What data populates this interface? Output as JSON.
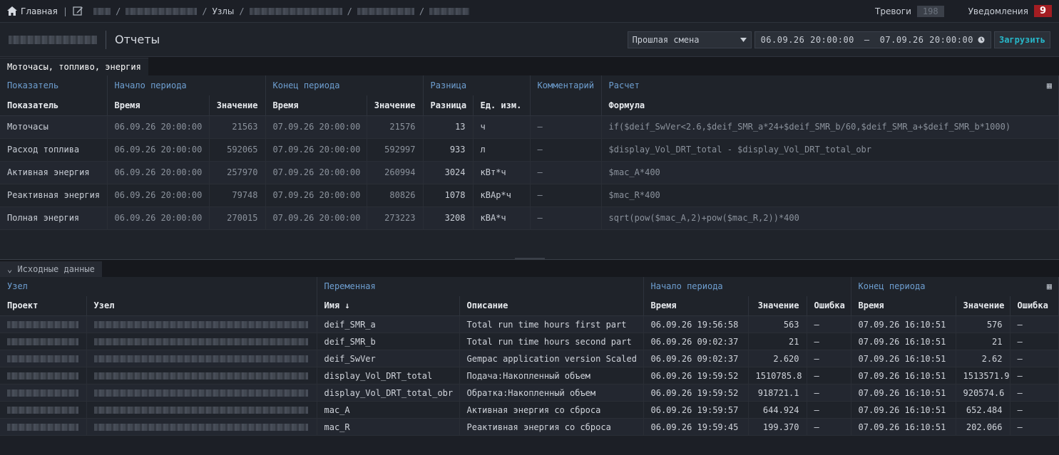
{
  "topbar": {
    "home_label": "Главная",
    "crumb_nodes": "Узлы",
    "alarms_label": "Тревоги",
    "alarms_count": "198",
    "notifications_label": "Уведомления",
    "notifications_count": "9"
  },
  "header": {
    "title": "Отчеты",
    "period_select": "Прошлая смена",
    "date_from": "06.09.26  20:00:00",
    "date_dash": "—",
    "date_to": "07.09.26  20:00:00",
    "load_button": "Загрузить"
  },
  "report_tab": "Моточасы, топливо, энергия",
  "report_table": {
    "groups": [
      "Показатель",
      "Начало периода",
      "Конец периода",
      "Разница",
      "Комментарий",
      "Расчет"
    ],
    "columns": [
      "Показатель",
      "Время",
      "Значение",
      "Время",
      "Значение",
      "Разница",
      "Ед. изм.",
      "",
      "Формула"
    ],
    "rows": [
      [
        "Моточасы",
        "06.09.26 20:00:00",
        "21563",
        "07.09.26 20:00:00",
        "21576",
        "13",
        "ч",
        "—",
        "if($deif_SwVer<2.6,$deif_SMR_a*24+$deif_SMR_b/60,$deif_SMR_a+$deif_SMR_b*1000)"
      ],
      [
        "Расход топлива",
        "06.09.26 20:00:00",
        "592065",
        "07.09.26 20:00:00",
        "592997",
        "933",
        "л",
        "—",
        "$display_Vol_DRT_total - $display_Vol_DRT_total_obr"
      ],
      [
        "Активная энергия",
        "06.09.26 20:00:00",
        "257970",
        "07.09.26 20:00:00",
        "260994",
        "3024",
        "кВт*ч",
        "—",
        "$mac_A*400"
      ],
      [
        "Реактивная энергия",
        "06.09.26 20:00:00",
        "79748",
        "07.09.26 20:00:00",
        "80826",
        "1078",
        "кВАр*ч",
        "—",
        "$mac_R*400"
      ],
      [
        "Полная энергия",
        "06.09.26 20:00:00",
        "270015",
        "07.09.26 20:00:00",
        "273223",
        "3208",
        "кВА*ч",
        "—",
        "sqrt(pow($mac_A,2)+pow($mac_R,2))*400"
      ]
    ]
  },
  "source_tab": "Исходные данные",
  "source_table": {
    "groups": [
      "Узел",
      "Переменная",
      "Начало периода",
      "Конец периода"
    ],
    "columns": [
      "Проект",
      "Узел",
      "Имя ↓",
      "Описание",
      "Время",
      "Значение",
      "Ошибка",
      "Время",
      "Значение",
      "Ошибка"
    ],
    "rows": [
      [
        "deif_SMR_a",
        "Total run time hours first part",
        "06.09.26 19:56:58",
        "563",
        "—",
        "07.09.26 16:10:51",
        "576",
        "—"
      ],
      [
        "deif_SMR_b",
        "Total run time hours second part",
        "06.09.26 09:02:37",
        "21",
        "—",
        "07.09.26 16:10:51",
        "21",
        "—"
      ],
      [
        "deif_SwVer",
        "Gempac application version Scaled",
        "06.09.26 09:02:37",
        "2.620",
        "—",
        "07.09.26 16:10:51",
        "2.62",
        "—"
      ],
      [
        "display_Vol_DRT_total",
        "Подача:Накопленный объем",
        "06.09.26 19:59:52",
        "1510785.8",
        "—",
        "07.09.26 16:10:51",
        "1513571.9",
        "—"
      ],
      [
        "display_Vol_DRT_total_obr",
        "Обратка:Накопленный объем",
        "06.09.26 19:59:52",
        "918721.1",
        "—",
        "07.09.26 16:10:51",
        "920574.6",
        "—"
      ],
      [
        "mac_A",
        "Активная энергия со сброса",
        "06.09.26 19:59:57",
        "644.924",
        "—",
        "07.09.26 16:10:51",
        "652.484",
        "—"
      ],
      [
        "mac_R",
        "Реактивная энергия со сброса",
        "06.09.26 19:59:45",
        "199.370",
        "—",
        "07.09.26 16:10:51",
        "202.066",
        "—"
      ]
    ]
  }
}
